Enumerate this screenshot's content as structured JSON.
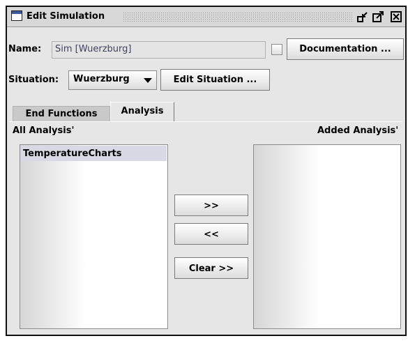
{
  "window": {
    "title": "Edit Simulation",
    "buttons": {
      "iconify": "▫↙",
      "maximize": "⤢",
      "close": "☒"
    }
  },
  "name_row": {
    "label": "Name:",
    "value": "Sim [Wuerzburg]",
    "checked": false,
    "documentation_button": "Documentation ..."
  },
  "situation_row": {
    "label": "Situation:",
    "selected": "Wuerzburg",
    "edit_button": "Edit Situation ..."
  },
  "tabs": [
    {
      "label": "End Functions",
      "active": false
    },
    {
      "label": "Analysis",
      "active": true
    }
  ],
  "analysis": {
    "all_label": "All Analysis'",
    "added_label": "Added Analysis'",
    "all_items": [
      "TemperatureCharts"
    ],
    "added_items": [],
    "buttons": {
      "add": ">>",
      "remove": "<<",
      "clear": "Clear >>"
    }
  }
}
